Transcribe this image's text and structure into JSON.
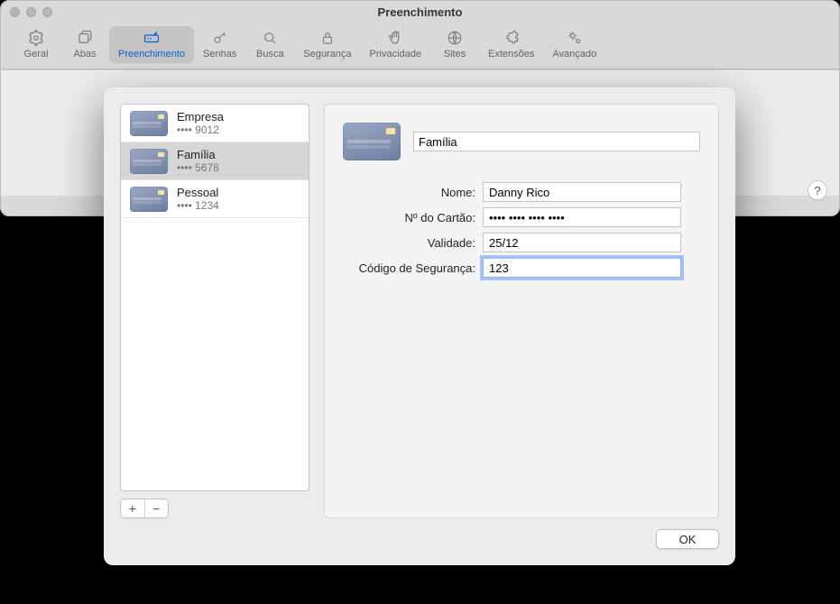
{
  "window": {
    "title": "Preenchimento"
  },
  "toolbar": {
    "items": [
      {
        "label": "Geral",
        "icon": "gear-icon"
      },
      {
        "label": "Abas",
        "icon": "tabs-icon"
      },
      {
        "label": "Preenchimento",
        "icon": "autofill-icon",
        "active": true
      },
      {
        "label": "Senhas",
        "icon": "key-icon"
      },
      {
        "label": "Busca",
        "icon": "search-icon"
      },
      {
        "label": "Segurança",
        "icon": "lock-icon"
      },
      {
        "label": "Privacidade",
        "icon": "hand-icon"
      },
      {
        "label": "Sites",
        "icon": "globe-icon"
      },
      {
        "label": "Extensões",
        "icon": "puzzle-icon"
      },
      {
        "label": "Avançado",
        "icon": "gears-icon"
      }
    ]
  },
  "help_label": "?",
  "cards": {
    "items": [
      {
        "name": "Empresa",
        "masked": "•••• 9012"
      },
      {
        "name": "Família",
        "masked": "•••• 5678",
        "selected": true
      },
      {
        "name": "Pessoal",
        "masked": "•••• 1234"
      }
    ]
  },
  "buttons": {
    "add": "+",
    "remove": "−",
    "ok": "OK"
  },
  "form": {
    "description_value": "Família",
    "labels": {
      "name": "Nome:",
      "number": "Nº do Cartão:",
      "expiry": "Validade:",
      "cvv": "Código de Segurança:"
    },
    "values": {
      "name": "Danny Rico",
      "number": "•••• •••• •••• ••••",
      "expiry": "25/12",
      "cvv": "123"
    }
  }
}
